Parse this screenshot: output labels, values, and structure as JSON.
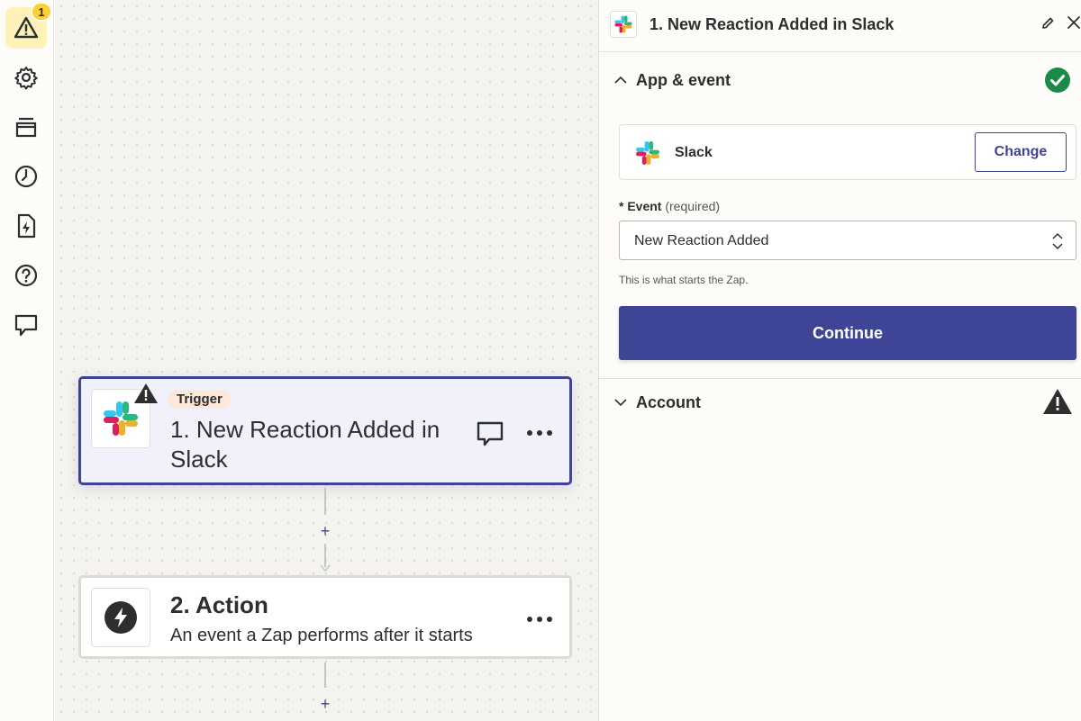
{
  "rail": {
    "warnings_badge": "1",
    "items": [
      {
        "name": "warning-icon"
      },
      {
        "name": "settings-gear-icon"
      },
      {
        "name": "versions-icon"
      },
      {
        "name": "history-clock-icon"
      },
      {
        "name": "zap-file-icon"
      },
      {
        "name": "help-icon"
      },
      {
        "name": "comments-icon"
      }
    ]
  },
  "canvas": {
    "trigger": {
      "pill": "Trigger",
      "title": "1. New Reaction Added in Slack",
      "icon": "slack-logo-icon"
    },
    "action": {
      "title": "2. Action",
      "description": "An event a Zap performs after it starts",
      "icon": "lightning-icon"
    },
    "add_step_label": "+"
  },
  "panel": {
    "title": "1. New Reaction Added in Slack",
    "app_event_section": {
      "label": "App & event",
      "status": "complete",
      "app_name": "Slack",
      "change_label": "Change",
      "event_label": "Event",
      "event_required": "(required)",
      "event_value": "New Reaction Added",
      "help_text": "This is what starts the Zap.",
      "continue_label": "Continue"
    },
    "account_section": {
      "label": "Account",
      "status": "warning"
    }
  },
  "colors": {
    "brand": "#3e4496",
    "success": "#1b8a47",
    "warning_badge": "#ffcf33",
    "trigger_pill_bg": "#fde8da"
  }
}
